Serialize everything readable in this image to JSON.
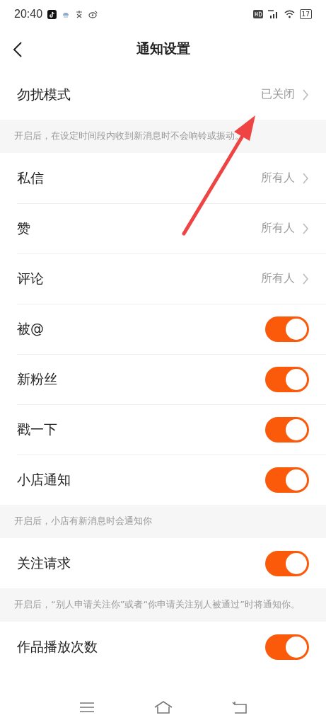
{
  "status_bar": {
    "time": "20:40",
    "battery": "17"
  },
  "header": {
    "title": "通知设置"
  },
  "sections": [
    {
      "rows": [
        {
          "kind": "link",
          "label": "勿扰模式",
          "value": "已关闭"
        }
      ],
      "note": "开启后，在设定时间段内收到新消息时不会响铃或振动。"
    },
    {
      "rows": [
        {
          "kind": "link",
          "label": "私信",
          "value": "所有人"
        },
        {
          "kind": "link",
          "label": "赞",
          "value": "所有人"
        },
        {
          "kind": "link",
          "label": "评论",
          "value": "所有人"
        },
        {
          "kind": "toggle",
          "label": "被@",
          "on": true
        },
        {
          "kind": "toggle",
          "label": "新粉丝",
          "on": true
        },
        {
          "kind": "toggle",
          "label": "戳一下",
          "on": true
        },
        {
          "kind": "toggle",
          "label": "小店通知",
          "on": true
        }
      ],
      "note": "开启后，小店有新消息时会通知你"
    },
    {
      "rows": [
        {
          "kind": "toggle",
          "label": "关注请求",
          "on": true
        }
      ],
      "note": "开启后，“别人申请关注你”或者“你申请关注别人被通过”时将通知你。"
    },
    {
      "rows": [
        {
          "kind": "toggle",
          "label": "作品播放次数",
          "on": true
        }
      ]
    }
  ],
  "annotation": {
    "kind": "arrow"
  }
}
